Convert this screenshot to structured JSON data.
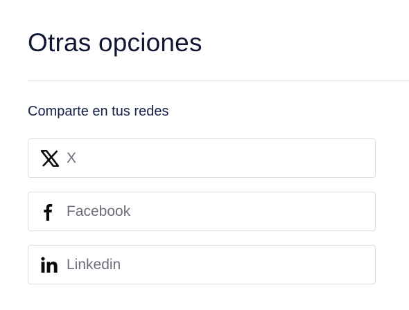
{
  "section": {
    "title": "Otras opciones",
    "share_heading": "Comparte en tus redes"
  },
  "share_options": [
    {
      "label": "X",
      "icon": "x-logo-icon"
    },
    {
      "label": "Facebook",
      "icon": "facebook-icon"
    },
    {
      "label": "Linkedin",
      "icon": "linkedin-icon"
    }
  ],
  "colors": {
    "title": "#0f1733",
    "icon": "#0b0b0b",
    "label": "#6b6f7a",
    "border": "#dadde3"
  }
}
